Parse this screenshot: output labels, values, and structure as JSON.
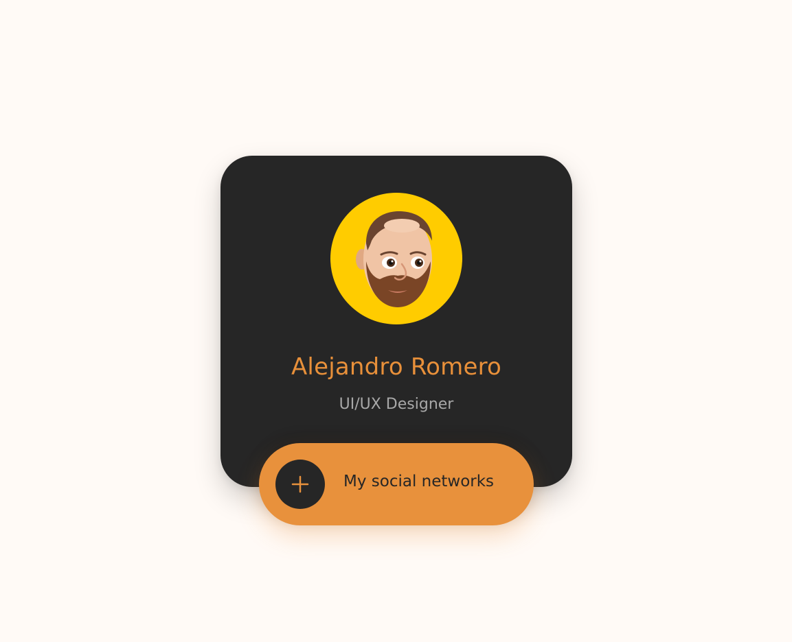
{
  "profile": {
    "name": "Alejandro Romero",
    "role": "UI/UX Designer"
  },
  "button": {
    "label": "My social networks",
    "icon": "plus-icon"
  },
  "colors": {
    "background": "#fffaf6",
    "card": "#262626",
    "accent": "#e8913c",
    "avatar_bg": "#ffcc00",
    "role_text": "#a8a8a8"
  }
}
